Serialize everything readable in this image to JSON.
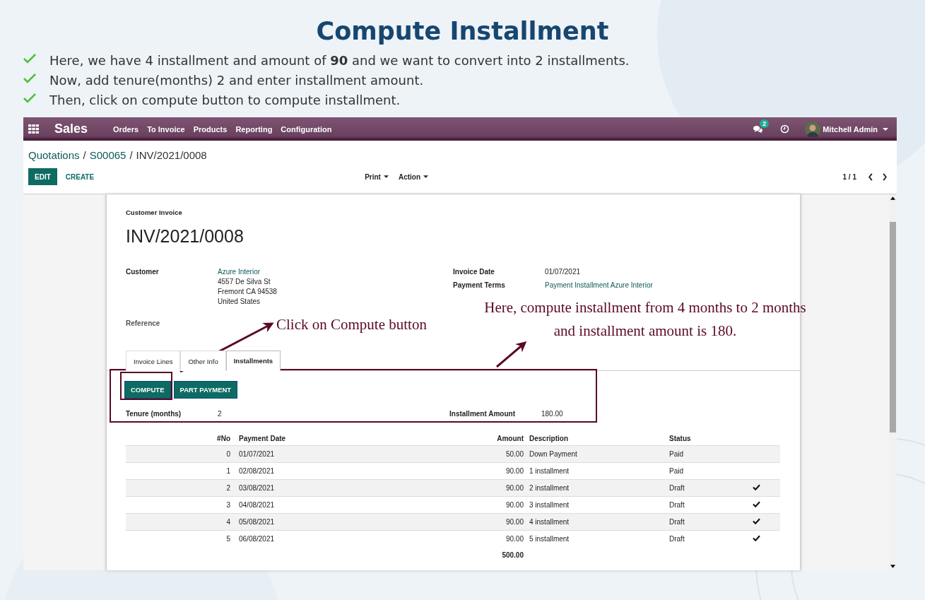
{
  "title": "Compute Installment",
  "bullets": [
    "Here, we have 4 installment and amount of **90** and we want to convert into 2 installments.",
    "Now, add tenure(months) 2 and enter installment amount.",
    "Then, click on compute button to compute installment."
  ],
  "navbar": {
    "app": "Sales",
    "menu": [
      "Orders",
      "To Invoice",
      "Products",
      "Reporting",
      "Configuration"
    ],
    "chat_badge": "2",
    "user": "Mitchell Admin"
  },
  "breadcrumb": [
    {
      "label": "Quotations",
      "link": true
    },
    {
      "separator": "/",
      "label": "S00065",
      "link": true
    },
    {
      "separator": "/",
      "label": "INV/2021/0008",
      "link": false
    }
  ],
  "buttons": {
    "edit": "EDIT",
    "create": "CREATE",
    "print": "Print",
    "action": "Action",
    "pager": "1 / 1"
  },
  "invoice": {
    "type_label": "Customer Invoice",
    "number": "INV/2021/0008",
    "customer_label": "Customer",
    "customer": "Azure Interior",
    "address": [
      "4557 De Silva St",
      "Fremont CA 94538",
      "United States"
    ],
    "reference_label": "Reference",
    "invoice_date_label": "Invoice Date",
    "invoice_date": "01/07/2021",
    "payment_terms_label": "Payment Terms",
    "payment_terms": "Payment Installment Azure Interior"
  },
  "tabs": [
    {
      "label": "Invoice Lines",
      "selected": false
    },
    {
      "label": "Other Info",
      "selected": false
    },
    {
      "label": "Installments",
      "selected": true
    }
  ],
  "installments": {
    "compute": "COMPUTE",
    "part_payment": "PART PAYMENT",
    "tenure_label": "Tenure (months)",
    "tenure": "2",
    "amount_label": "Installment Amount",
    "amount": "180.00"
  },
  "table": {
    "columns": [
      "#No",
      "Payment Date",
      "Amount",
      "Description",
      "Status"
    ],
    "rows": [
      {
        "no": "0",
        "date": "01/07/2021",
        "amount": "50.00",
        "description": "Down Payment",
        "status": "Paid",
        "checked": false
      },
      {
        "no": "1",
        "date": "02/08/2021",
        "amount": "90.00",
        "description": "1 installment",
        "status": "Paid",
        "checked": false
      },
      {
        "no": "2",
        "date": "03/08/2021",
        "amount": "90.00",
        "description": "2 installment",
        "status": "Draft",
        "checked": true
      },
      {
        "no": "3",
        "date": "04/08/2021",
        "amount": "90.00",
        "description": "3 installment",
        "status": "Draft",
        "checked": true
      },
      {
        "no": "4",
        "date": "05/08/2021",
        "amount": "90.00",
        "description": "4 installment",
        "status": "Draft",
        "checked": true
      },
      {
        "no": "5",
        "date": "06/08/2021",
        "amount": "90.00",
        "description": "5 installment",
        "status": "Draft",
        "checked": true
      }
    ],
    "total": "500.00"
  },
  "annotations": {
    "compute_note": "Click on Compute button",
    "amount_note": [
      "Here, compute installment from 4 months to 2 months",
      "and installment amount is 180."
    ]
  }
}
